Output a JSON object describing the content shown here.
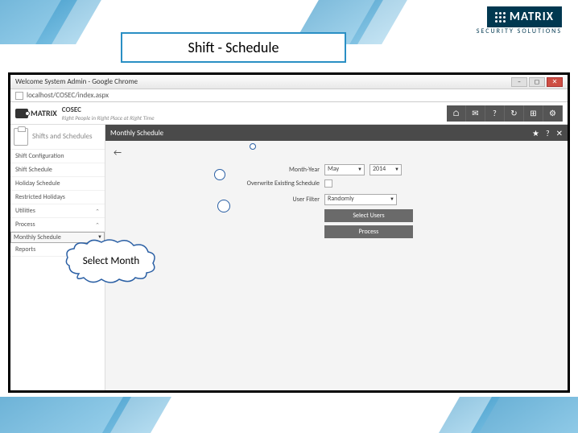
{
  "slide": {
    "title": "Shift - Schedule",
    "logo_text": "MATRIX",
    "logo_sub": "SECURITY SOLUTIONS",
    "callout": "Select Month"
  },
  "chrome": {
    "title": "Welcome System Admin - Google Chrome",
    "url": "localhost/COSEC/index.aspx"
  },
  "app": {
    "brand": "MATRIX",
    "product": "COSEC",
    "tagline": "Right People in Right Place at Right Time"
  },
  "top_icons": [
    "⌂",
    "✉",
    "?",
    "↻",
    "⊞",
    "⚙"
  ],
  "sidebar": {
    "heading": "Shifts and Schedules",
    "items": [
      {
        "label": "Shift Configuration",
        "expand": false
      },
      {
        "label": "Shift Schedule",
        "expand": false
      },
      {
        "label": "Holiday Schedule",
        "expand": false
      },
      {
        "label": "Restricted Holidays",
        "expand": false
      },
      {
        "label": "Utilities",
        "expand": true
      },
      {
        "label": "Process",
        "expand": true
      },
      {
        "label": "Monthly Schedule",
        "expand": false,
        "sel": true
      },
      {
        "label": "Reports",
        "expand": true
      }
    ]
  },
  "main": {
    "title": "Monthly Schedule",
    "right_icons": [
      "★",
      "?",
      "✕"
    ],
    "back": "←",
    "form": {
      "month_year_label": "Month-Year",
      "month": "May",
      "year": "2014",
      "overwrite_label": "Overwrite Existing Schedule",
      "filter_label": "User Filter",
      "filter_value": "Randomly",
      "btn_select": "Select Users",
      "btn_process": "Process"
    }
  }
}
